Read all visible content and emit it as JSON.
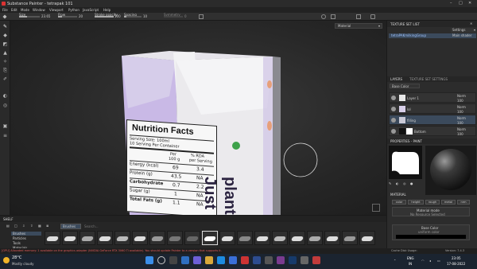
{
  "window": {
    "title": "Substance Painter - tetrapak 101"
  },
  "menu": [
    "File",
    "Edit",
    "Mode",
    "Window",
    "Viewport",
    "Python",
    "JavaScript",
    "Help"
  ],
  "tool_options": {
    "size_label": "Size",
    "size_value": "23.65",
    "flow_label": "Flow",
    "flow_value": "20",
    "stroke_opacity_label": "Stroke opacity",
    "stroke_opacity_value": "100",
    "spacing_label": "Spacing",
    "spacing_value": "10",
    "symmetry_label": "Symmetry",
    "symmetry_value": "0"
  },
  "viewport": {
    "mode_select": "Material"
  },
  "package": {
    "title": "Nutrition Facts",
    "serving_size": "Serving Size: 100ml",
    "serving_count": "10 Serving Per Container",
    "col_per": "Per",
    "col_per2": "100 g",
    "col_rda": "% RDA",
    "col_rda2": "per Serving",
    "rows": [
      {
        "name": "Energy (kcal)",
        "per": "69",
        "rda": "3.4"
      },
      {
        "name": "Protein (g)",
        "per": "43.5",
        "rda": "NA"
      },
      {
        "name": "Carbohydrate",
        "per": "0.7",
        "rda": "2.2"
      },
      {
        "name": "Sugar (g)",
        "per": "1",
        "rda": "NA"
      },
      {
        "name": "Total Fats (g)",
        "per": "1.1",
        "rda": "NA"
      }
    ],
    "brand_1": "Just",
    "brand_2": "plants"
  },
  "texture_set_list": {
    "title": "TEXTURE SET LIST",
    "settings_label": "Settings",
    "item_name": "tetraPAKmilkingGroup",
    "item_shader": "Main shader"
  },
  "layers": {
    "tab_layers": "LAYERS",
    "tab_settings": "TEXTURE SET SETTINGS",
    "channel_select": "Base Color",
    "items": [
      {
        "name": "Layer 1",
        "blend": "Norm",
        "opacity": "100"
      },
      {
        "name": "lol",
        "blend": "Norm",
        "opacity": "100"
      },
      {
        "name": "filling",
        "blend": "Norm",
        "opacity": "100"
      },
      {
        "name": "Bottom",
        "blend": "Norm",
        "opacity": "100"
      }
    ]
  },
  "properties": {
    "title": "PROPERTIES - PAINT",
    "section_material": "MATERIAL",
    "chips": [
      "color",
      "height",
      "rough",
      "metal",
      "nrm"
    ],
    "material_mode": "Material mode",
    "no_resource": "No Resource Selected",
    "base_color": "Base Color",
    "uniform_color": "uniform color"
  },
  "shelf": {
    "title": "SHELF",
    "search_placeholder": "Search...",
    "filter_tag": "Brushes",
    "categories": [
      "Brushes",
      "Particles",
      "Tools",
      "Materials"
    ]
  },
  "status": {
    "message": "[GPU] Allocated memory: 1 available on the graphics adapter (NVIDIA GeForce RTX 3060 Ti available). You should update Painter to a version that supports it.",
    "cache": "Cache Disk Usage:",
    "version": "Version: 7.4.3"
  },
  "taskbar": {
    "weather_temp": "28°C",
    "weather_desc": "Mostly cloudy",
    "lang_1": "ENG",
    "lang_2": "IN",
    "time": "23:05",
    "date": "17-08-2022",
    "search_label": "Search"
  },
  "colors": {
    "accent": "#4a7dbf",
    "panel": "#2c2c2c",
    "carton_lilac": "#c9b9e6"
  }
}
